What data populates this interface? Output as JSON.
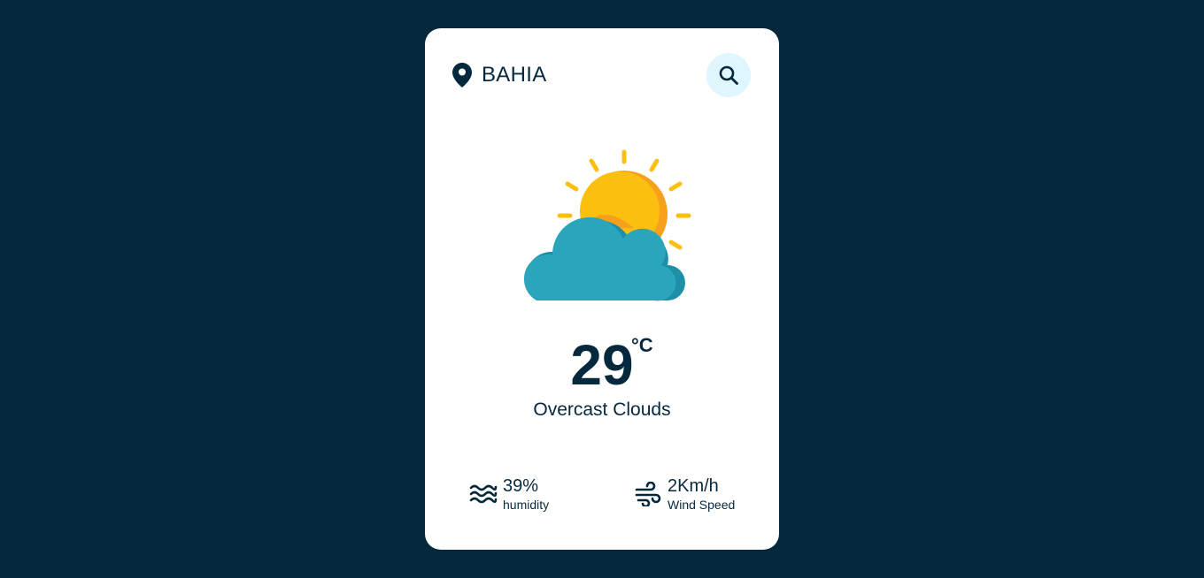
{
  "location": {
    "city": "BAHIA",
    "icon": "map-pin-icon"
  },
  "search": {
    "icon": "search-icon"
  },
  "weather": {
    "illustration": "partly-cloudy-icon",
    "temperature": "29",
    "unit": "°C",
    "description": "Overcast Clouds"
  },
  "details": {
    "humidity": {
      "icon": "humidity-waves-icon",
      "value": "39%",
      "label": "humidity"
    },
    "wind": {
      "icon": "wind-icon",
      "value": "2Km/h",
      "label": "Wind Speed"
    }
  },
  "colors": {
    "background": "#06283d",
    "card": "#ffffff",
    "search_button_bg": "#dff6ff",
    "text": "#06283d",
    "sun": "#fbbf0f",
    "sun_shade": "#f7a01c",
    "cloud": "#2aa5bc",
    "cloud_shade": "#1d8fa7"
  }
}
